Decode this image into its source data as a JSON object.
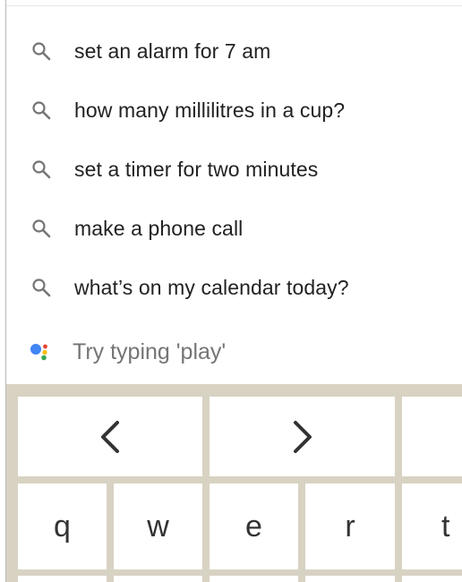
{
  "suggestions": [
    {
      "icon": "search-icon",
      "text": "set an alarm for 7 am"
    },
    {
      "icon": "search-icon",
      "text": "how many millilitres in a cup?"
    },
    {
      "icon": "search-icon",
      "text": "set a timer for two minutes"
    },
    {
      "icon": "search-icon",
      "text": "make a phone call"
    },
    {
      "icon": "search-icon",
      "text": "what’s on my calendar today?"
    }
  ],
  "hint": {
    "icon": "google-assistant-icon",
    "text": "Try typing 'play'"
  },
  "keyboard": {
    "nav_keys": [
      {
        "icon": "chevron-left-icon"
      },
      {
        "icon": "chevron-right-icon"
      }
    ],
    "letter_keys": [
      "q",
      "w",
      "e",
      "r",
      "t"
    ]
  },
  "colors": {
    "keyboard_background": "#d8d2c3",
    "key_background": "#ffffff",
    "text_primary": "#222222",
    "text_hint": "#757575",
    "icon_grey": "#757575",
    "assistant_blue": "#4285F4",
    "assistant_red": "#EA4335",
    "assistant_yellow": "#FBBC05",
    "assistant_green": "#34A853"
  }
}
